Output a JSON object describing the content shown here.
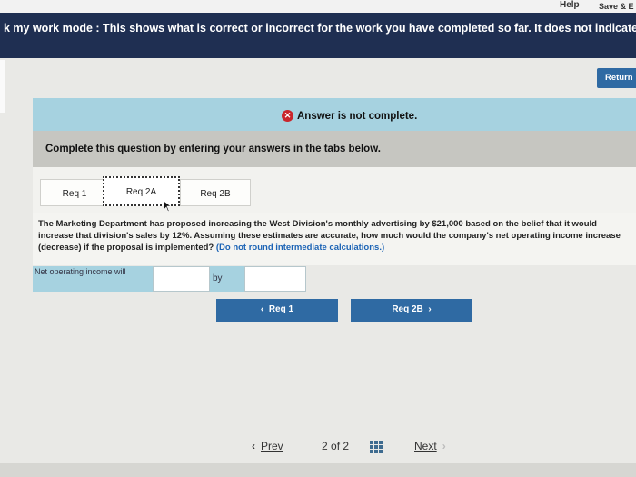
{
  "top": {
    "help_label": "Help",
    "save_label": "Save & E"
  },
  "banner": {
    "text": "k my work mode : This shows what is correct or incorrect for the work you have completed so far. It does not indicate com"
  },
  "return_label": "Return",
  "answer_status": "Answer is not complete.",
  "instruction": "Complete this question by entering your answers in the tabs below.",
  "tabs": [
    {
      "label": "Req 1"
    },
    {
      "label": "Req 2A"
    },
    {
      "label": "Req 2B"
    }
  ],
  "question": {
    "text": "The Marketing Department has proposed increasing the West Division's monthly advertising by $21,000 based on the belief that it would increase that division's sales by 12%. Assuming these estimates are accurate, how much would the company's net operating income increase (decrease) if the proposal is implemented?",
    "note": "(Do not round intermediate calculations.)"
  },
  "answer_row": {
    "label": "Net operating income will",
    "by_label": "by",
    "value1": "",
    "value2": ""
  },
  "nav": {
    "prev_label": "Req 1",
    "next_label": "Req 2B"
  },
  "pager": {
    "prev_label": "Prev",
    "current": "2",
    "of_label": "of",
    "total": "2",
    "next_label": "Next"
  },
  "colors": {
    "banner": "#1f2f52",
    "accent_blue": "#2f6aa3",
    "answer_bar": "#a6d2e0",
    "error_red": "#c9262c"
  }
}
